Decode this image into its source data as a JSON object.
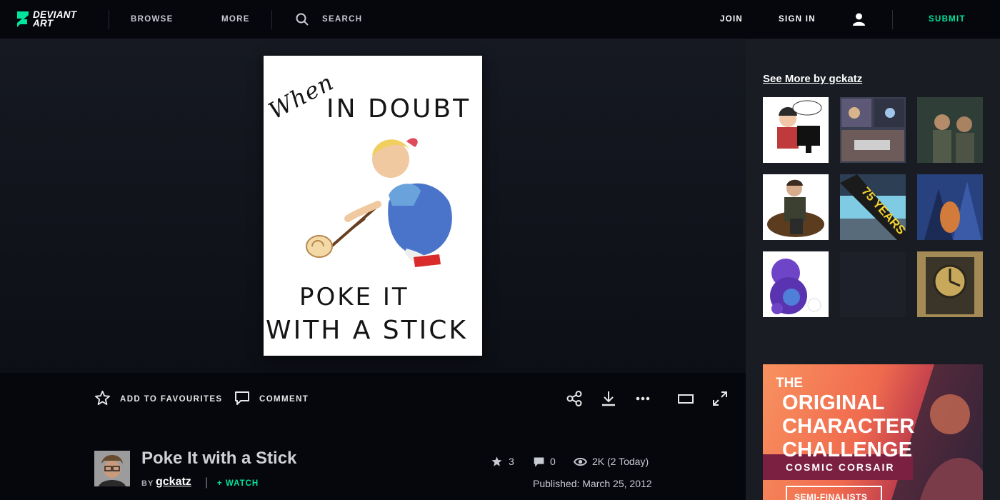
{
  "brand": {
    "logo_line1": "DEVIANT",
    "logo_line2": "ART",
    "accent": "#00e59b"
  },
  "nav": {
    "browse": "BROWSE",
    "more": "MORE",
    "search_label": "SEARCH",
    "join": "JOIN",
    "sign_in": "SIGN IN",
    "submit": "SUBMIT"
  },
  "artwork": {
    "text_line1": "When",
    "text_line2": "IN DOUBT",
    "text_line3": "POKE  IT",
    "text_line4": "WITH A STICK"
  },
  "sidebar": {
    "see_more": "See More by gckatz",
    "thumbnails": [
      "comic-desk",
      "comic-panels",
      "soldiers",
      "sitting-man",
      "75-years",
      "blue-forest",
      "purple-dragon",
      "empty",
      "clock-drawing"
    ]
  },
  "ad": {
    "the": "THE",
    "line1": "ORIGINAL",
    "line2": "CHARACTER",
    "line3": "CHALLENGE",
    "subtitle": "COSMIC CORSAIR",
    "button": "SEMI-FINALISTS"
  },
  "actions": {
    "favourite": "ADD TO FAVOURITES",
    "comment": "COMMENT"
  },
  "deviation": {
    "title": "Poke It with a Stick",
    "by": "BY",
    "author": "gckatz",
    "separator": "|",
    "watch": "+ WATCH",
    "favourites": "3",
    "comments": "0",
    "views": "2K (2 Today)",
    "published": "Published: March 25, 2012"
  }
}
